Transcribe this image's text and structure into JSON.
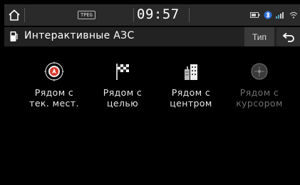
{
  "status": {
    "tpeg_label": "TPEG",
    "time": "09:57"
  },
  "header": {
    "title": "Интерактивные АЗС",
    "type_button_label": "Тип"
  },
  "options": [
    {
      "label": "Рядом с\nтек. мест.",
      "icon": "current-location-icon",
      "enabled": true
    },
    {
      "label": "Рядом с\nцелью",
      "icon": "checkered-flag-icon",
      "enabled": true
    },
    {
      "label": "Рядом с\nцентром",
      "icon": "city-buildings-icon",
      "enabled": true
    },
    {
      "label": "Рядом с\nкурсором",
      "icon": "cursor-crosshair-icon",
      "enabled": false
    }
  ],
  "colors": {
    "background": "#000000",
    "bar": "#2a2a2a",
    "location_red": "#d8382c",
    "disabled_text": "#6f6f6f"
  }
}
